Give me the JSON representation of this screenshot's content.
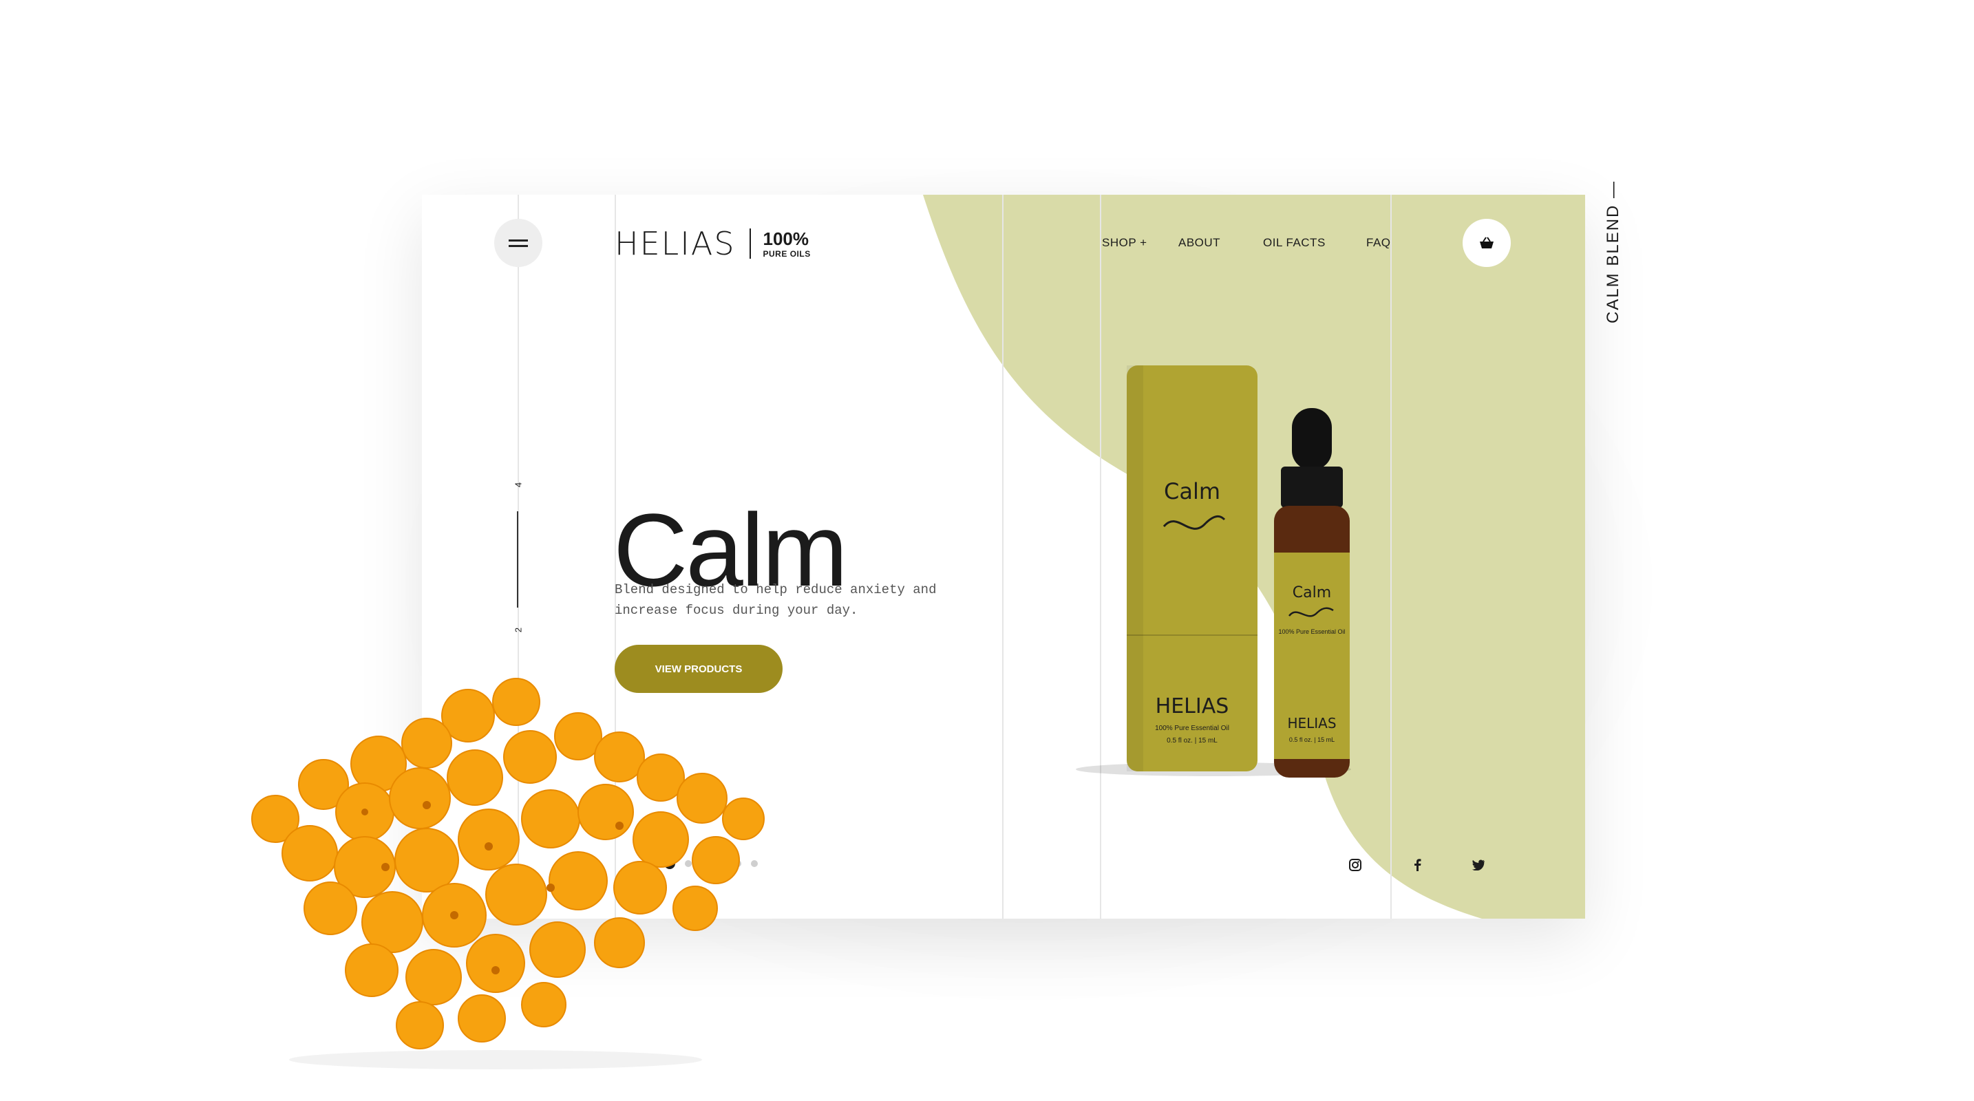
{
  "brand": {
    "name": "HELIAS",
    "tag_big": "100%",
    "tag_small": "PURE OILS"
  },
  "nav": {
    "items": [
      "SHOP +",
      "ABOUT",
      "OIL FACTS",
      "FAQ"
    ]
  },
  "slides": {
    "top_number": "4",
    "bottom_number": "2"
  },
  "hero": {
    "title": "Calm",
    "description": "Blend designed to help reduce anxiety and increase focus during your day.",
    "cta_label": "VIEW PRODUCTS"
  },
  "product": {
    "tube_title": "Calm",
    "tube_brand": "HELIAS",
    "tube_sub": "100% Pure Essential Oil",
    "tube_size": "0.5 fl oz.  |  15 mL",
    "bottle_title": "Calm",
    "bottle_sub": "100% Pure Essential Oil",
    "bottle_brand": "HELIAS",
    "bottle_size": "0.5 fl oz.  |  15 mL"
  },
  "side_label": "CALM BLEND —",
  "icons": {
    "menu": "hamburger-icon",
    "cart": "basket-icon",
    "instagram": "instagram-icon",
    "facebook": "facebook-icon",
    "twitter": "twitter-icon"
  },
  "colors": {
    "accent_green": "#d9dba8",
    "button": "#9d8c1f",
    "tube": "#b0a432",
    "flower": "#f7a20f"
  }
}
